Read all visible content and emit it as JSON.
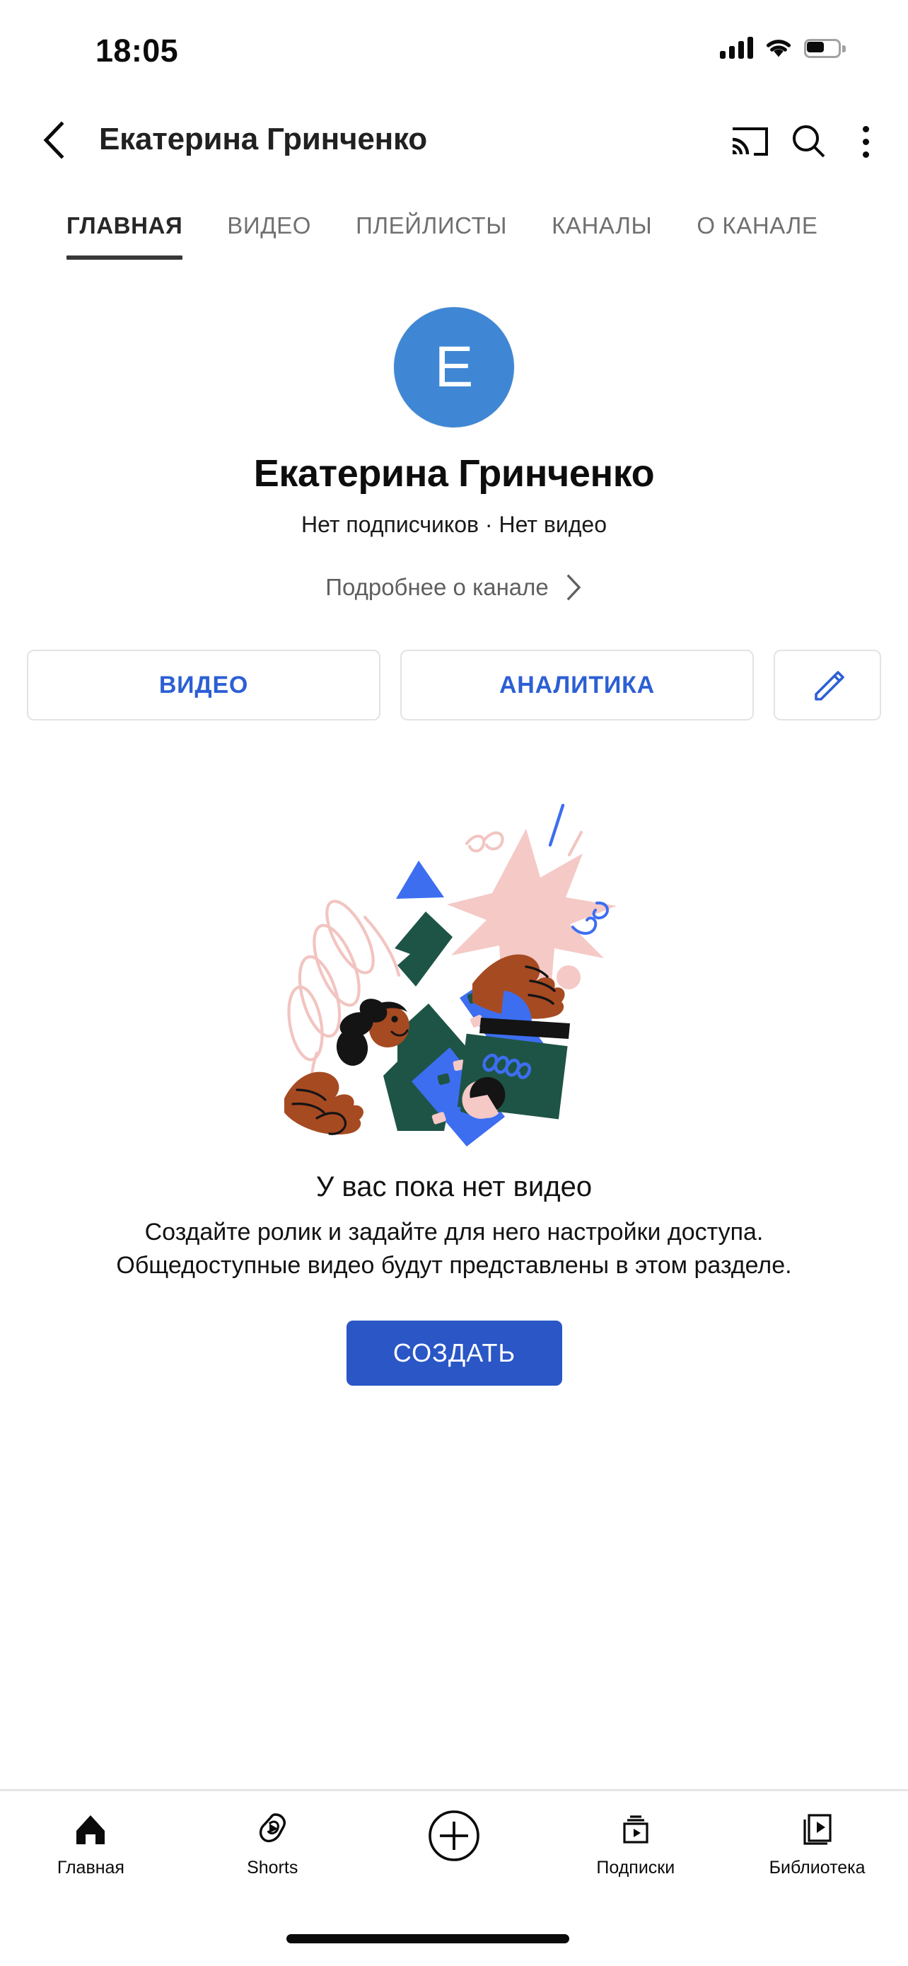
{
  "status_bar": {
    "time": "18:05",
    "signal_icon": "cellular-signal-icon",
    "wifi_icon": "wifi-icon",
    "battery_icon": "battery-icon",
    "battery_level_percent": 55
  },
  "header": {
    "back_icon": "chevron-left-icon",
    "title": "Екатерина Гринченко",
    "cast_icon": "cast-icon",
    "search_icon": "search-icon",
    "overflow_icon": "more-vertical-icon"
  },
  "tabs": [
    {
      "label": "ГЛАВНАЯ",
      "active": true
    },
    {
      "label": "ВИДЕО",
      "active": false
    },
    {
      "label": "ПЛЕЙЛИСТЫ",
      "active": false
    },
    {
      "label": "КАНАЛЫ",
      "active": false
    },
    {
      "label": "О КАНАЛЕ",
      "active": false
    }
  ],
  "channel": {
    "avatar_letter": "E",
    "avatar_color": "#3f87d4",
    "display_name": "Екатерина Гринченко",
    "meta": "Нет подписчиков · Нет видео",
    "more_label": "Подробнее о канале",
    "more_chevron_icon": "chevron-right-icon"
  },
  "actions": {
    "videos_label": "ВИДЕО",
    "analytics_label": "АНАЛИТИКА",
    "edit_icon": "pencil-icon",
    "accent_color": "#2d5fd4"
  },
  "empty_state": {
    "illustration_icon": "no-videos-illustration",
    "title": "У вас пока нет видео",
    "description_line1": "Создайте ролик и задайте для него настройки доступа.",
    "description_line2": "Общедоступные видео будут представлены в этом разделе.",
    "cta_label": "СОЗДАТЬ",
    "cta_color": "#2a56c6"
  },
  "bottom_nav": [
    {
      "label": "Главная",
      "icon": "home-icon",
      "active": true
    },
    {
      "label": "Shorts",
      "icon": "shorts-icon",
      "active": false
    },
    {
      "label": "",
      "icon": "plus-circle-icon",
      "active": false
    },
    {
      "label": "Подписки",
      "icon": "subscriptions-icon",
      "active": false
    },
    {
      "label": "Библиотека",
      "icon": "library-icon",
      "active": false
    }
  ]
}
